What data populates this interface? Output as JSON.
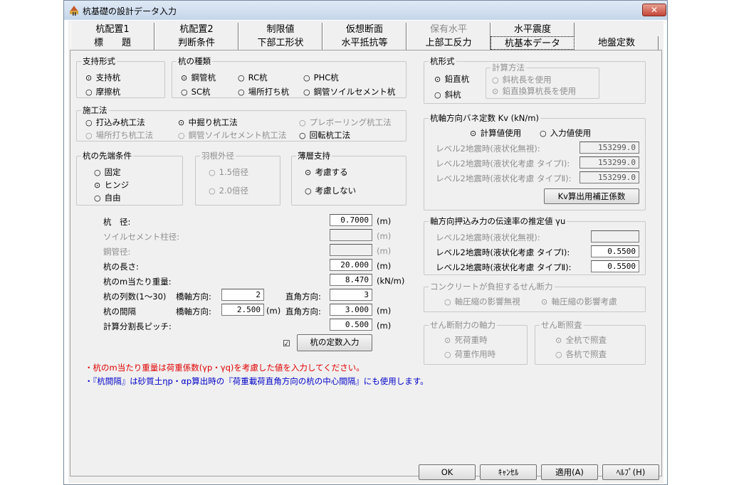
{
  "window": {
    "title": "杭基礎の設計データ入力",
    "close": "✕"
  },
  "tabs_row1": [
    "杭配置1",
    "杭配置2",
    "制限値",
    "仮想断面",
    "保有水平",
    "水平震度"
  ],
  "tabs_row2": [
    "標　　題",
    "判断条件",
    "下部工形状",
    "水平抵抗等",
    "上部工反力",
    "杭基本データ",
    "地盤定数"
  ],
  "support": {
    "legend": "支持形式",
    "opt1": "支持杭",
    "opt2": "摩擦杭"
  },
  "pile_type": {
    "legend": "杭の種類",
    "opt1": "鋼管杭",
    "opt2": "RC杭",
    "opt3": "PHC杭",
    "opt4": "SC杭",
    "opt5": "場所打ち杭",
    "opt6": "鋼管ソイルセメント杭"
  },
  "method": {
    "legend": "施工法",
    "opt1": "打込み杭工法",
    "opt2": "中掘り杭工法",
    "opt3": "プレボーリング杭工法",
    "opt4": "場所打ち杭工法",
    "opt5": "鋼管ソイルセメント杭工法",
    "opt6": "回転杭工法"
  },
  "tip": {
    "legend": "杭の先端条件",
    "opt1": "固定",
    "opt2": "ヒンジ",
    "opt3": "自由"
  },
  "wing": {
    "legend": "羽根外径",
    "opt1": "1.5倍径",
    "opt2": "2.0倍径"
  },
  "thin": {
    "legend": "薄層支持",
    "opt1": "考慮する",
    "opt2": "考慮しない"
  },
  "fields": {
    "diameter_label": "杭　径:",
    "diameter": "0.7000",
    "unit_m": "(m)",
    "soil_cement_label": "ソイルセメント柱径:",
    "steel_label": "鋼管径:",
    "length_label": "杭の長さ:",
    "length": "20.000",
    "weight_label": "杭のm当たり重量:",
    "weight": "8.470",
    "unit_kn": "(kN/m)",
    "rows_label": "杭の列数(1〜30)",
    "bridge_axis": "橋軸方向:",
    "rows_bridge": "2",
    "perp": "直角方向:",
    "rows_perp": "3",
    "spacing_label": "杭の間隔",
    "spacing_bridge": "2.500",
    "spacing_perp": "3.000",
    "pitch_label": "計算分割長ピッチ:",
    "pitch": "0.500"
  },
  "pile_const_button": "杭の定数入力",
  "pile_form": {
    "legend": "杭形式",
    "opt1": "鉛直杭",
    "opt2": "斜杭",
    "calc_legend": "計算方法",
    "calc1": "斜杭長を使用",
    "calc2": "鉛直換算杭長を使用"
  },
  "kv": {
    "legend": "杭軸方向バネ定数 Kv (kN/m)",
    "opt1": "計算値使用",
    "opt2": "入力値使用",
    "l1": "レベル2地震時(液状化無視):",
    "v1": "153299.0",
    "l2": "レベル2地震時(液状化考慮 タイプⅠ):",
    "v2": "153299.0",
    "l3": "レベル2地震時(液状化考慮 タイプⅡ):",
    "v3": "153299.0",
    "button": "Kv算出用補正係数"
  },
  "gamma": {
    "legend": "軸方向押込み力の伝達率の推定値 γu",
    "l1": "レベル2地震時(液状化無視):",
    "l2": "レベル2地震時(液状化考慮 タイプⅠ):",
    "v2": "0.5500",
    "l3": "レベル2地震時(液状化考慮 タイプⅡ):",
    "v3": "0.5500"
  },
  "shear": {
    "legend": "コンクリートが負担するせん断力",
    "opt1": "軸圧縮の影響無視",
    "opt2": "軸圧縮の影響考慮"
  },
  "axial": {
    "legend": "せん断耐力の軸力",
    "opt1": "死荷重時",
    "opt2": "荷重作用時"
  },
  "check": {
    "legend": "せん断照査",
    "opt1": "全杭で照査",
    "opt2": "各杭で照査"
  },
  "notes": {
    "red": "・杭のm当たり重量は荷重係数(γp・γq)を考慮した値を入力してください。",
    "blue": "・『杭間隔』は砂質土ηp・αp算出時の『荷重載荷直角方向の杭の中心間隔』にも使用します。"
  },
  "buttons": {
    "ok": "OK",
    "cancel": "ｷｬﾝｾﾙ",
    "apply": "適用(A)",
    "help": "ﾍﾙﾌﾟ(H)"
  },
  "colors": {
    "note_red": "#e00000",
    "note_blue": "#0000c8"
  }
}
